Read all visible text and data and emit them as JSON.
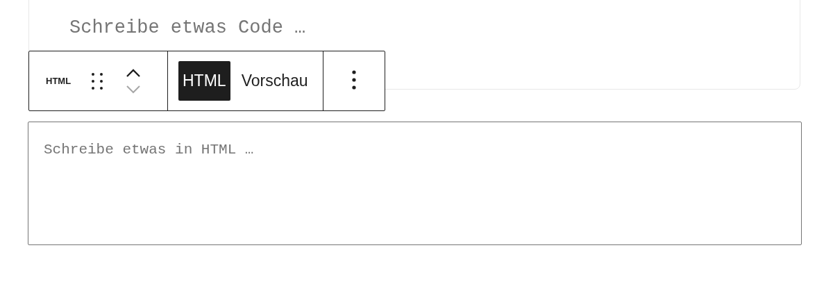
{
  "code_block": {
    "placeholder": "Schreibe etwas Code …"
  },
  "toolbar": {
    "block_label": "HTML",
    "move_up": {
      "disabled": false
    },
    "move_down": {
      "disabled": true
    },
    "tabs": [
      {
        "label": "HTML",
        "selected": true
      },
      {
        "label": "Vorschau",
        "selected": false
      }
    ]
  },
  "html_editor": {
    "placeholder": "Schreibe etwas in HTML …"
  }
}
